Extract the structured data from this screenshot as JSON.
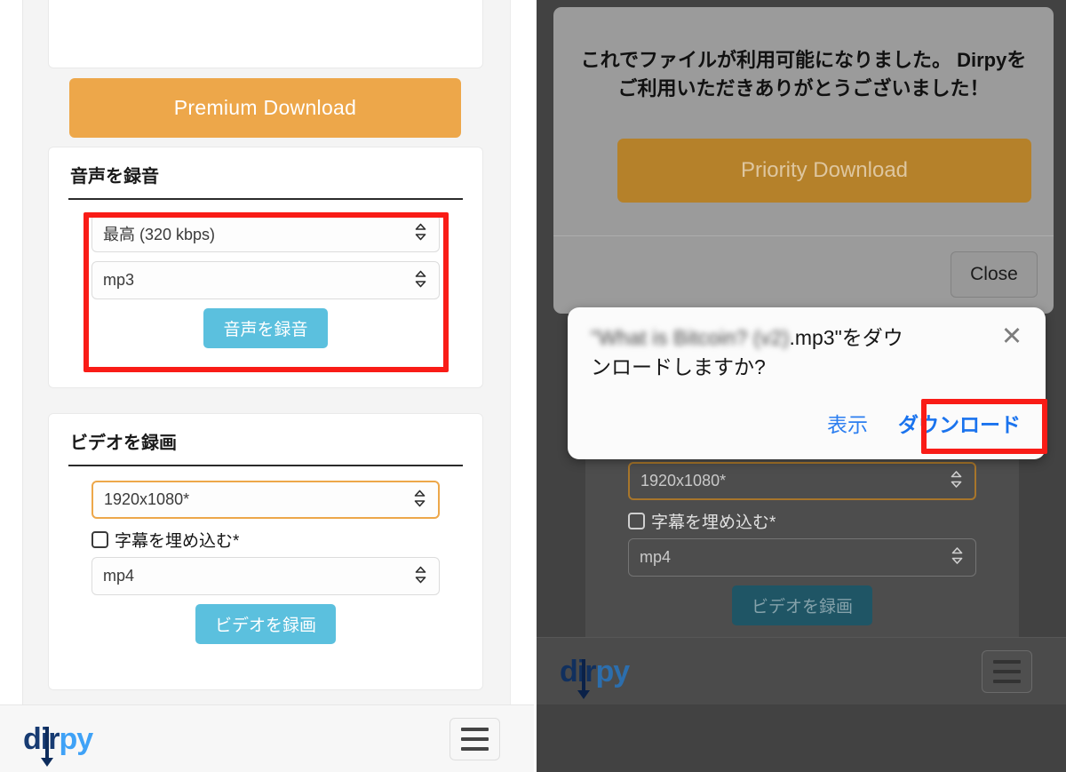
{
  "left": {
    "premium_button": "Premium Download",
    "audio_section": {
      "title": "音声を録音",
      "quality_value": "最高 (320 kbps)",
      "format_value": "mp3",
      "action_button": "音声を録音"
    },
    "video_section": {
      "title": "ビデオを録画",
      "resolution_value": "1920x1080*",
      "subtitle_checkbox_label": "字幕を埋め込む*",
      "format_value": "mp4",
      "action_button": "ビデオを録画"
    },
    "footer": {
      "logo_dark": "d",
      "logo_i": "i",
      "logo_r": "r",
      "logo_lite": "py",
      "menu_icon": "hamburger-icon"
    }
  },
  "right": {
    "modal": {
      "message": "これでファイルが利用可能になりました。 Dirpyをご利用いただきありがとうございました！",
      "priority_button": "Priority Download",
      "close_button": "Close"
    },
    "toast": {
      "filename_blurred": "\"What is Bitcoin? (v2)",
      "filename_visible": ".mp3\"をダウ",
      "question_line2": "ンロードしますか?",
      "close_icon": "✕",
      "view_button": "表示",
      "download_button": "ダウンロード"
    },
    "page": {
      "resolution_value": "1920x1080*",
      "subtitle_checkbox_label": "字幕を埋め込む*",
      "format_value": "mp4",
      "action_button": "ビデオを録画"
    },
    "footer": {
      "logo_dark": "d",
      "logo_i": "i",
      "logo_r": "r",
      "logo_lite": "py",
      "menu_icon": "hamburger-icon"
    }
  },
  "icons": {
    "select_caret": "⇳"
  },
  "colors": {
    "orange": "#eda74a",
    "blue": "#5bc0de",
    "highlight_red": "#f91c17",
    "link_blue": "#2c7ef0",
    "priority_brown": "#b5812a"
  }
}
